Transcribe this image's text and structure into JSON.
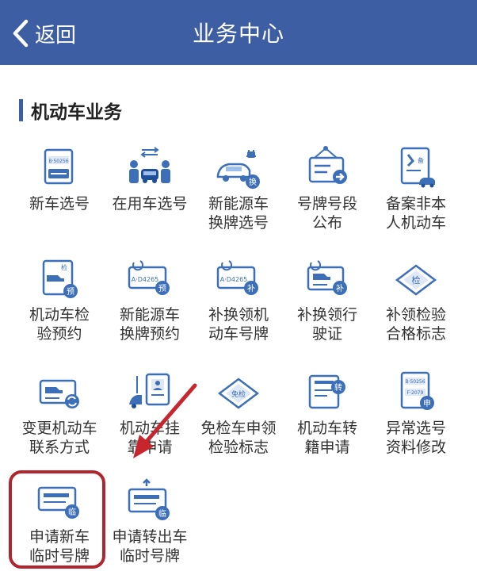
{
  "header": {
    "back_label": "返回",
    "title": "业务中心"
  },
  "section": {
    "title": "机动车业务"
  },
  "colors": {
    "header": "#3d5ea3",
    "icon_blue": "#3d6fb8",
    "highlight": "#b0262f"
  },
  "tiles": [
    {
      "label": "新车选号",
      "icon": "plate-card-icon"
    },
    {
      "label": "在用车选号",
      "icon": "people-car-exchange-icon"
    },
    {
      "label": "新能源车\n换牌选号",
      "icon": "ev-car-exchange-icon"
    },
    {
      "label": "号牌号段\n公布",
      "icon": "sign-board-arrow-icon"
    },
    {
      "label": "备案非本\n人机动车",
      "icon": "record-document-car-icon"
    },
    {
      "label": "机动车检\n验预约",
      "icon": "inspection-reserve-icon"
    },
    {
      "label": "新能源车\n换牌预约",
      "icon": "ev-plate-reserve-icon"
    },
    {
      "label": "补换领机\n动车号牌",
      "icon": "plate-replace-icon"
    },
    {
      "label": "补换领行\n驶证",
      "icon": "license-replace-icon"
    },
    {
      "label": "补领检验\n合格标志",
      "icon": "inspection-diamond-icon"
    },
    {
      "label": "变更机动车\n联系方式",
      "icon": "contact-change-icon"
    },
    {
      "label": "机动车挂\n靠申请",
      "icon": "affiliation-icon"
    },
    {
      "label": "免检车申领\n检验标志",
      "icon": "exempt-diamond-icon"
    },
    {
      "label": "机动车转\n籍申请",
      "icon": "transfer-document-icon"
    },
    {
      "label": "异常选号\n资料修改",
      "icon": "abnormal-plate-edit-icon"
    },
    {
      "label": "申请新车\n临时号牌",
      "icon": "temp-plate-icon"
    },
    {
      "label": "申请转出车\n临时号牌",
      "icon": "temp-plate-upload-icon"
    }
  ],
  "badges": {
    "car_badge": "换",
    "reserve_badge": "预",
    "replace_badge": "补",
    "change_badge": "转",
    "temp_badge": "临",
    "inspect_mark": "检",
    "exempt_mark": "免检",
    "record_mark": "备",
    "plate_text": "A·D4265",
    "plate_small": "B·50256",
    "plate_small2": "F·2079",
    "apply_badge": "申"
  }
}
